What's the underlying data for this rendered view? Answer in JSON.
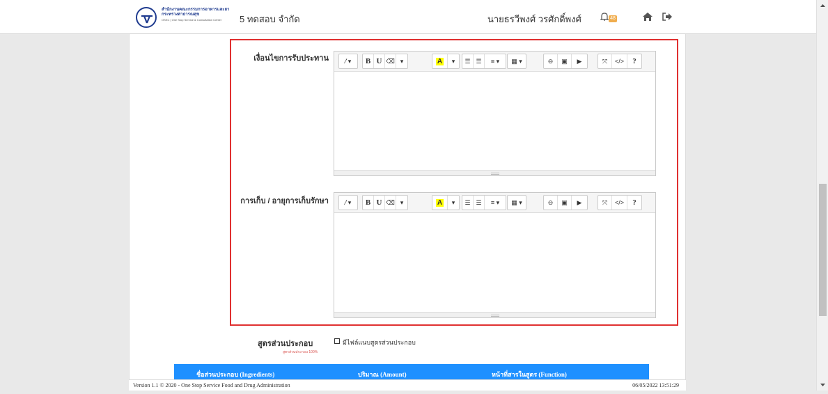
{
  "header": {
    "logo_lines": [
      "สำนักงานคณะกรรมการอาหารและยา",
      "กระทรวงสาธารณสุข",
      "OSSC | One Stop Service & Consultation Center"
    ],
    "company": "5 ทดสอบ จำกัด",
    "username": "นายธรวีพงศ์ วรศักดิ์พงศ์",
    "notification_count": "48"
  },
  "form": {
    "field1_label": "เงื่อนไขการรับประทาน",
    "field2_label": "การเก็บ / อายุการเก็บรักษา",
    "formula_label": "สูตรส่วนประกอบ",
    "formula_note": "สูตรส่วนประกอบ 100%",
    "attach_checkbox_label": "มีไฟล์แนบสูตรส่วนประกอบ"
  },
  "toolbar": {
    "magic": "⁄̇̇ ▾",
    "bold": "B",
    "underline": "U",
    "eraser": "⌫",
    "font_dropdown": "▾",
    "highlight": "A",
    "highlight_dropdown": "▾",
    "ul": "☰",
    "ol": "☰",
    "align": "≡ ▾",
    "table": "▦ ▾",
    "link": "⊖",
    "picture": "▣",
    "video": "▶",
    "fullscreen": "⤧",
    "code": "</>",
    "help": "?"
  },
  "table": {
    "columns": [
      "ชื่อส่วนประกอบ (Ingredients)",
      "ปริมาณ (Amount)",
      "หน้าที่สารในสูตร (Function)"
    ]
  },
  "footer": {
    "version": "Version 1.1 © 2020 - One Stop Service Food and Drug Administration",
    "datetime": "06/05/2022 13:51:29"
  },
  "colors": {
    "highlight_box": "#e03030",
    "table_header": "#1e90ff",
    "badge": "#f0ad4e"
  }
}
